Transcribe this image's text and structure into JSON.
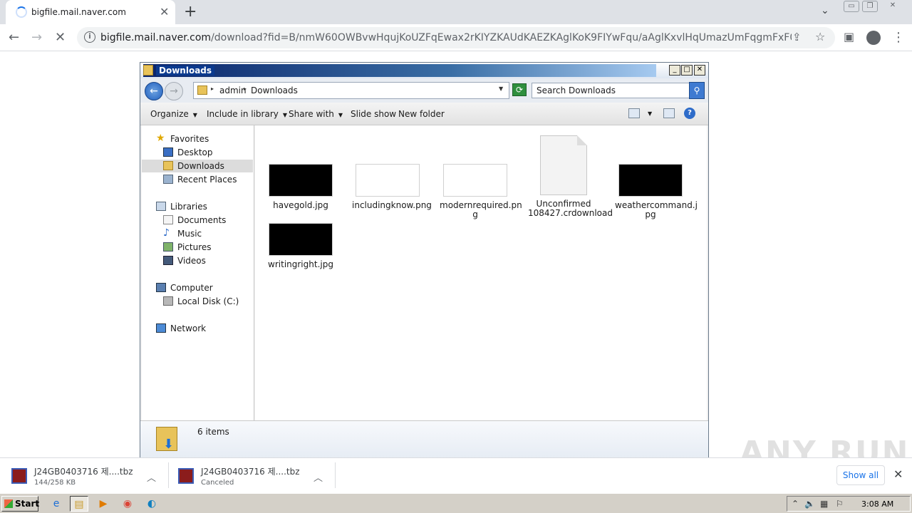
{
  "browser": {
    "tab_title": "bigfile.mail.naver.com",
    "url_host": "bigfile.mail.naver.com",
    "url_path": "/download?fid=B/nmW60OWBvwHqujKoUZFqEwax2rKIYZKAUdKAEZKAglKoK9FIYwFqu/aAglKxvlHqUmazUmFqgmFxF0pokSp6koFrtrp..."
  },
  "explorer": {
    "title": "Downloads",
    "breadcrumb": [
      "admin",
      "Downloads"
    ],
    "search_placeholder": "Search Downloads",
    "commands": {
      "organize": "Organize",
      "include": "Include in library",
      "share": "Share with",
      "slideshow": "Slide show",
      "newfolder": "New folder"
    },
    "nav": {
      "favorites": "Favorites",
      "desktop": "Desktop",
      "downloads": "Downloads",
      "recent": "Recent Places",
      "libraries": "Libraries",
      "documents": "Documents",
      "music": "Music",
      "pictures": "Pictures",
      "videos": "Videos",
      "computer": "Computer",
      "localdisk": "Local Disk (C:)",
      "network": "Network"
    },
    "files": [
      {
        "name": "havegold.jpg",
        "thumb": "black"
      },
      {
        "name": "includingknow.png",
        "thumb": "white"
      },
      {
        "name": "modernrequired.pn\ng",
        "thumb": "white"
      },
      {
        "name": "Unconfirmed\n108427.crdownload",
        "thumb": "doc"
      },
      {
        "name": "weathercommand.j\npg",
        "thumb": "black"
      },
      {
        "name": "writingright.jpg",
        "thumb": "black"
      }
    ],
    "status": "6 items"
  },
  "downloads": [
    {
      "name": "J24GB0403716  제....tbz",
      "sub": "144/258 KB"
    },
    {
      "name": "J24GB0403716  제....tbz",
      "sub": "Canceled"
    }
  ],
  "shelf": {
    "show_all": "Show all"
  },
  "watermark": "ANY RUN",
  "taskbar": {
    "start": "Start",
    "clock": "3:08 AM"
  }
}
